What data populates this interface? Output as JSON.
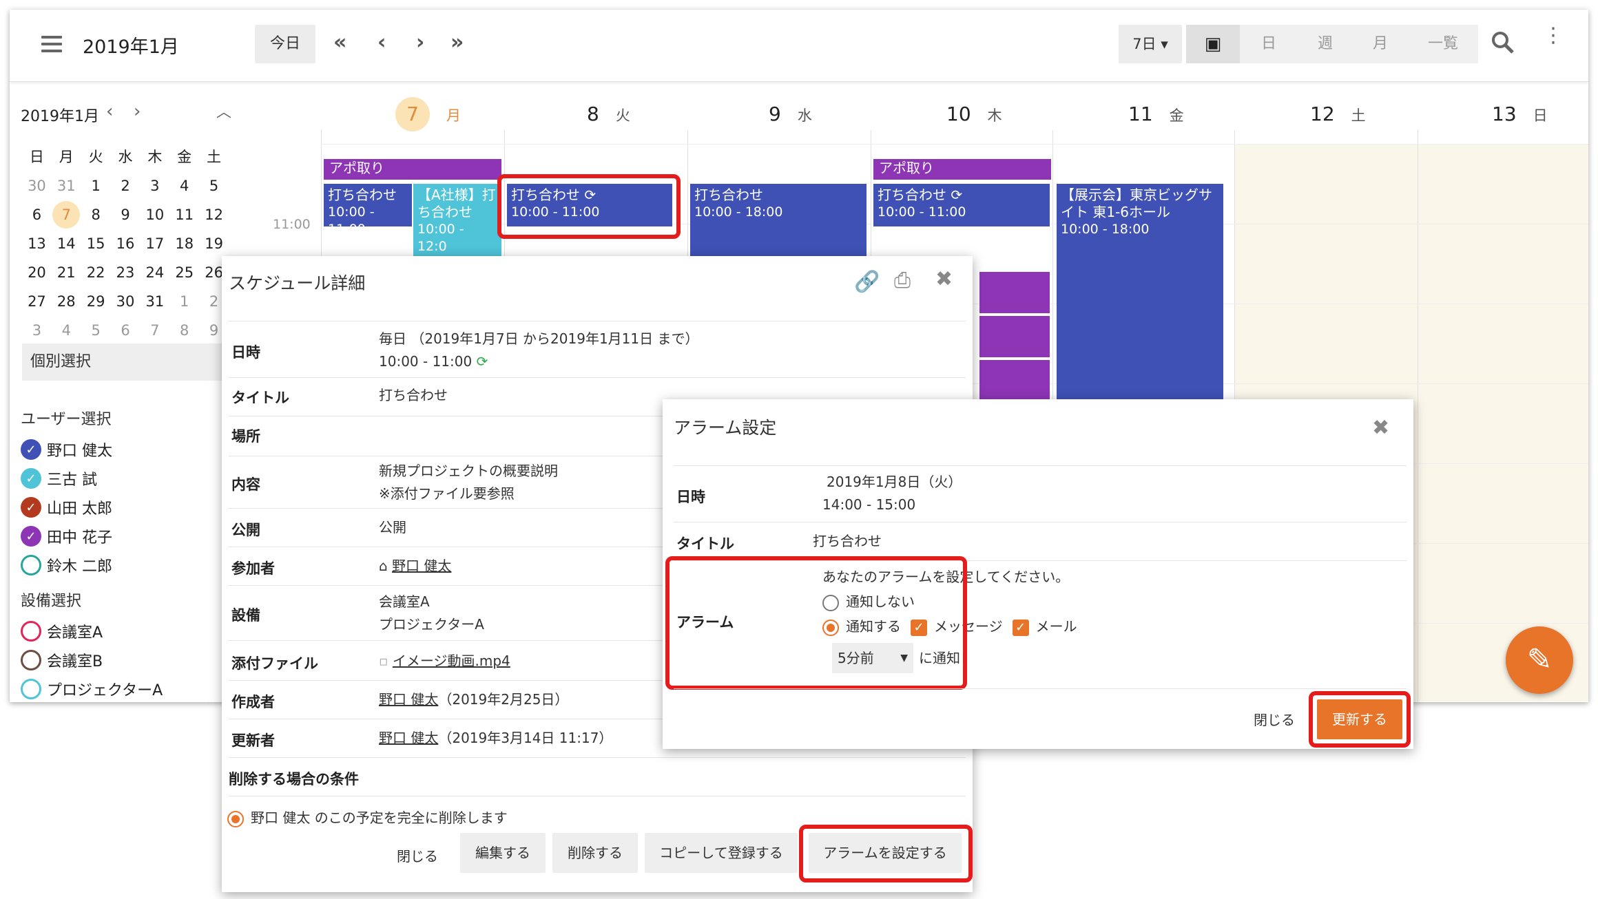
{
  "header": {
    "month_title": "2019年1月",
    "today_label": "今日",
    "range_select": "7日 ▾",
    "views": [
      "日",
      "週",
      "月",
      "一覧"
    ]
  },
  "mini_calendar": {
    "title": "2019年1月",
    "weekdays": [
      "日",
      "月",
      "火",
      "水",
      "木",
      "金",
      "土"
    ],
    "weeks": [
      [
        "30",
        "31",
        "1",
        "2",
        "3",
        "4",
        "5"
      ],
      [
        "6",
        "7",
        "8",
        "9",
        "10",
        "11",
        "12"
      ],
      [
        "13",
        "14",
        "15",
        "16",
        "17",
        "18",
        "19"
      ],
      [
        "20",
        "21",
        "22",
        "23",
        "24",
        "25",
        "26"
      ],
      [
        "27",
        "28",
        "29",
        "30",
        "31",
        "1",
        "2"
      ],
      [
        "3",
        "4",
        "5",
        "6",
        "7",
        "8",
        "9"
      ]
    ],
    "individual_select": "個別選択"
  },
  "sidebar": {
    "user_section": "ユーザー選択",
    "users": [
      {
        "name": "野口 健太",
        "color": "#3f51b5"
      },
      {
        "name": "三古 試",
        "color": "#4fc3d8"
      },
      {
        "name": "山田 太郎",
        "color": "#b33a1f"
      },
      {
        "name": "田中 花子",
        "color": "#8e35b6"
      },
      {
        "name": "鈴木 二郎",
        "color": "#26a69a"
      }
    ],
    "facility_section": "設備選択",
    "facilities": [
      {
        "name": "会議室A",
        "color": "#e2245a"
      },
      {
        "name": "会議室B",
        "color": "#6d4c41"
      },
      {
        "name": "プロジェクターA",
        "color": "#4fc3d8"
      }
    ]
  },
  "week": {
    "days": [
      {
        "num": "7",
        "dow": "月"
      },
      {
        "num": "8",
        "dow": "火"
      },
      {
        "num": "9",
        "dow": "水"
      },
      {
        "num": "10",
        "dow": "木"
      },
      {
        "num": "11",
        "dow": "金"
      },
      {
        "num": "12",
        "dow": "土"
      },
      {
        "num": "13",
        "dow": "日"
      }
    ],
    "time_label": "11:00",
    "events": {
      "appo1": "アポ取り",
      "appo2": "アポ取り",
      "mtg_label": "打ち合わせ",
      "mtg_time": "10:00 - 11:00",
      "mtg_time_short": "10:00 - 11:00",
      "acompany": "【A社様】打ち合わせ",
      "acompany_time": "10:00 - 12:0",
      "mtg9_time": "10:00 - 18:00",
      "expo": "【展示会】東京ビッグサイト 東1-6ホール",
      "expo_time": "10:00 - 18:00"
    }
  },
  "schedule_dialog": {
    "title": "スケジュール詳細",
    "rows": {
      "datetime_label": "日時",
      "datetime_line1": "毎日 （2019年1月7日 から2019年1月11日 まで）",
      "datetime_line2": "10:00 - 11:00",
      "title_label": "タイトル",
      "title_val": "打ち合わせ",
      "place_label": "場所",
      "content_label": "内容",
      "content_line1": "新規プロジェクトの概要説明",
      "content_line2": "※添付ファイル要参照",
      "public_label": "公開",
      "public_val": "公開",
      "participant_label": "参加者",
      "participant_val": "野口 健太",
      "facility_label": "設備",
      "facility_line1": "会議室A",
      "facility_line2": "プロジェクターA",
      "attach_label": "添付ファイル",
      "attach_val": "イメージ動画.mp4",
      "creator_label": "作成者",
      "creator_name": "野口 健太",
      "creator_date": "（2019年2月25日）",
      "updater_label": "更新者",
      "updater_name": "野口 健太",
      "updater_date": "（2019年3月14日 11:17）"
    },
    "delete_condition_title": "削除する場合の条件",
    "delete_option": "野口 健太 のこの予定を完全に削除します",
    "buttons": {
      "close": "閉じる",
      "edit": "編集する",
      "delete": "削除する",
      "copy": "コピーして登録する",
      "alarm": "アラームを設定する"
    }
  },
  "alarm_dialog": {
    "title": "アラーム設定",
    "datetime_label": "日時",
    "datetime_line1": "2019年1月8日（火）",
    "datetime_line2": "14:00 - 15:00",
    "title_label": "タイトル",
    "title_val": "打ち合わせ",
    "alarm_label": "アラーム",
    "prompt": "あなたのアラームを設定してください。",
    "opt_none": "通知しない",
    "opt_notify": "通知する",
    "cb_message": "メッセージ",
    "cb_mail": "メール",
    "timing_select": "5分前",
    "timing_suffix": "に通知",
    "close": "閉じる",
    "update": "更新する"
  },
  "colors": {
    "indigo": "#3f51b5",
    "purple": "#8e35b6",
    "cyan": "#4fc3d8",
    "orange": "#e8742a",
    "highlight": "#e51c1c"
  }
}
